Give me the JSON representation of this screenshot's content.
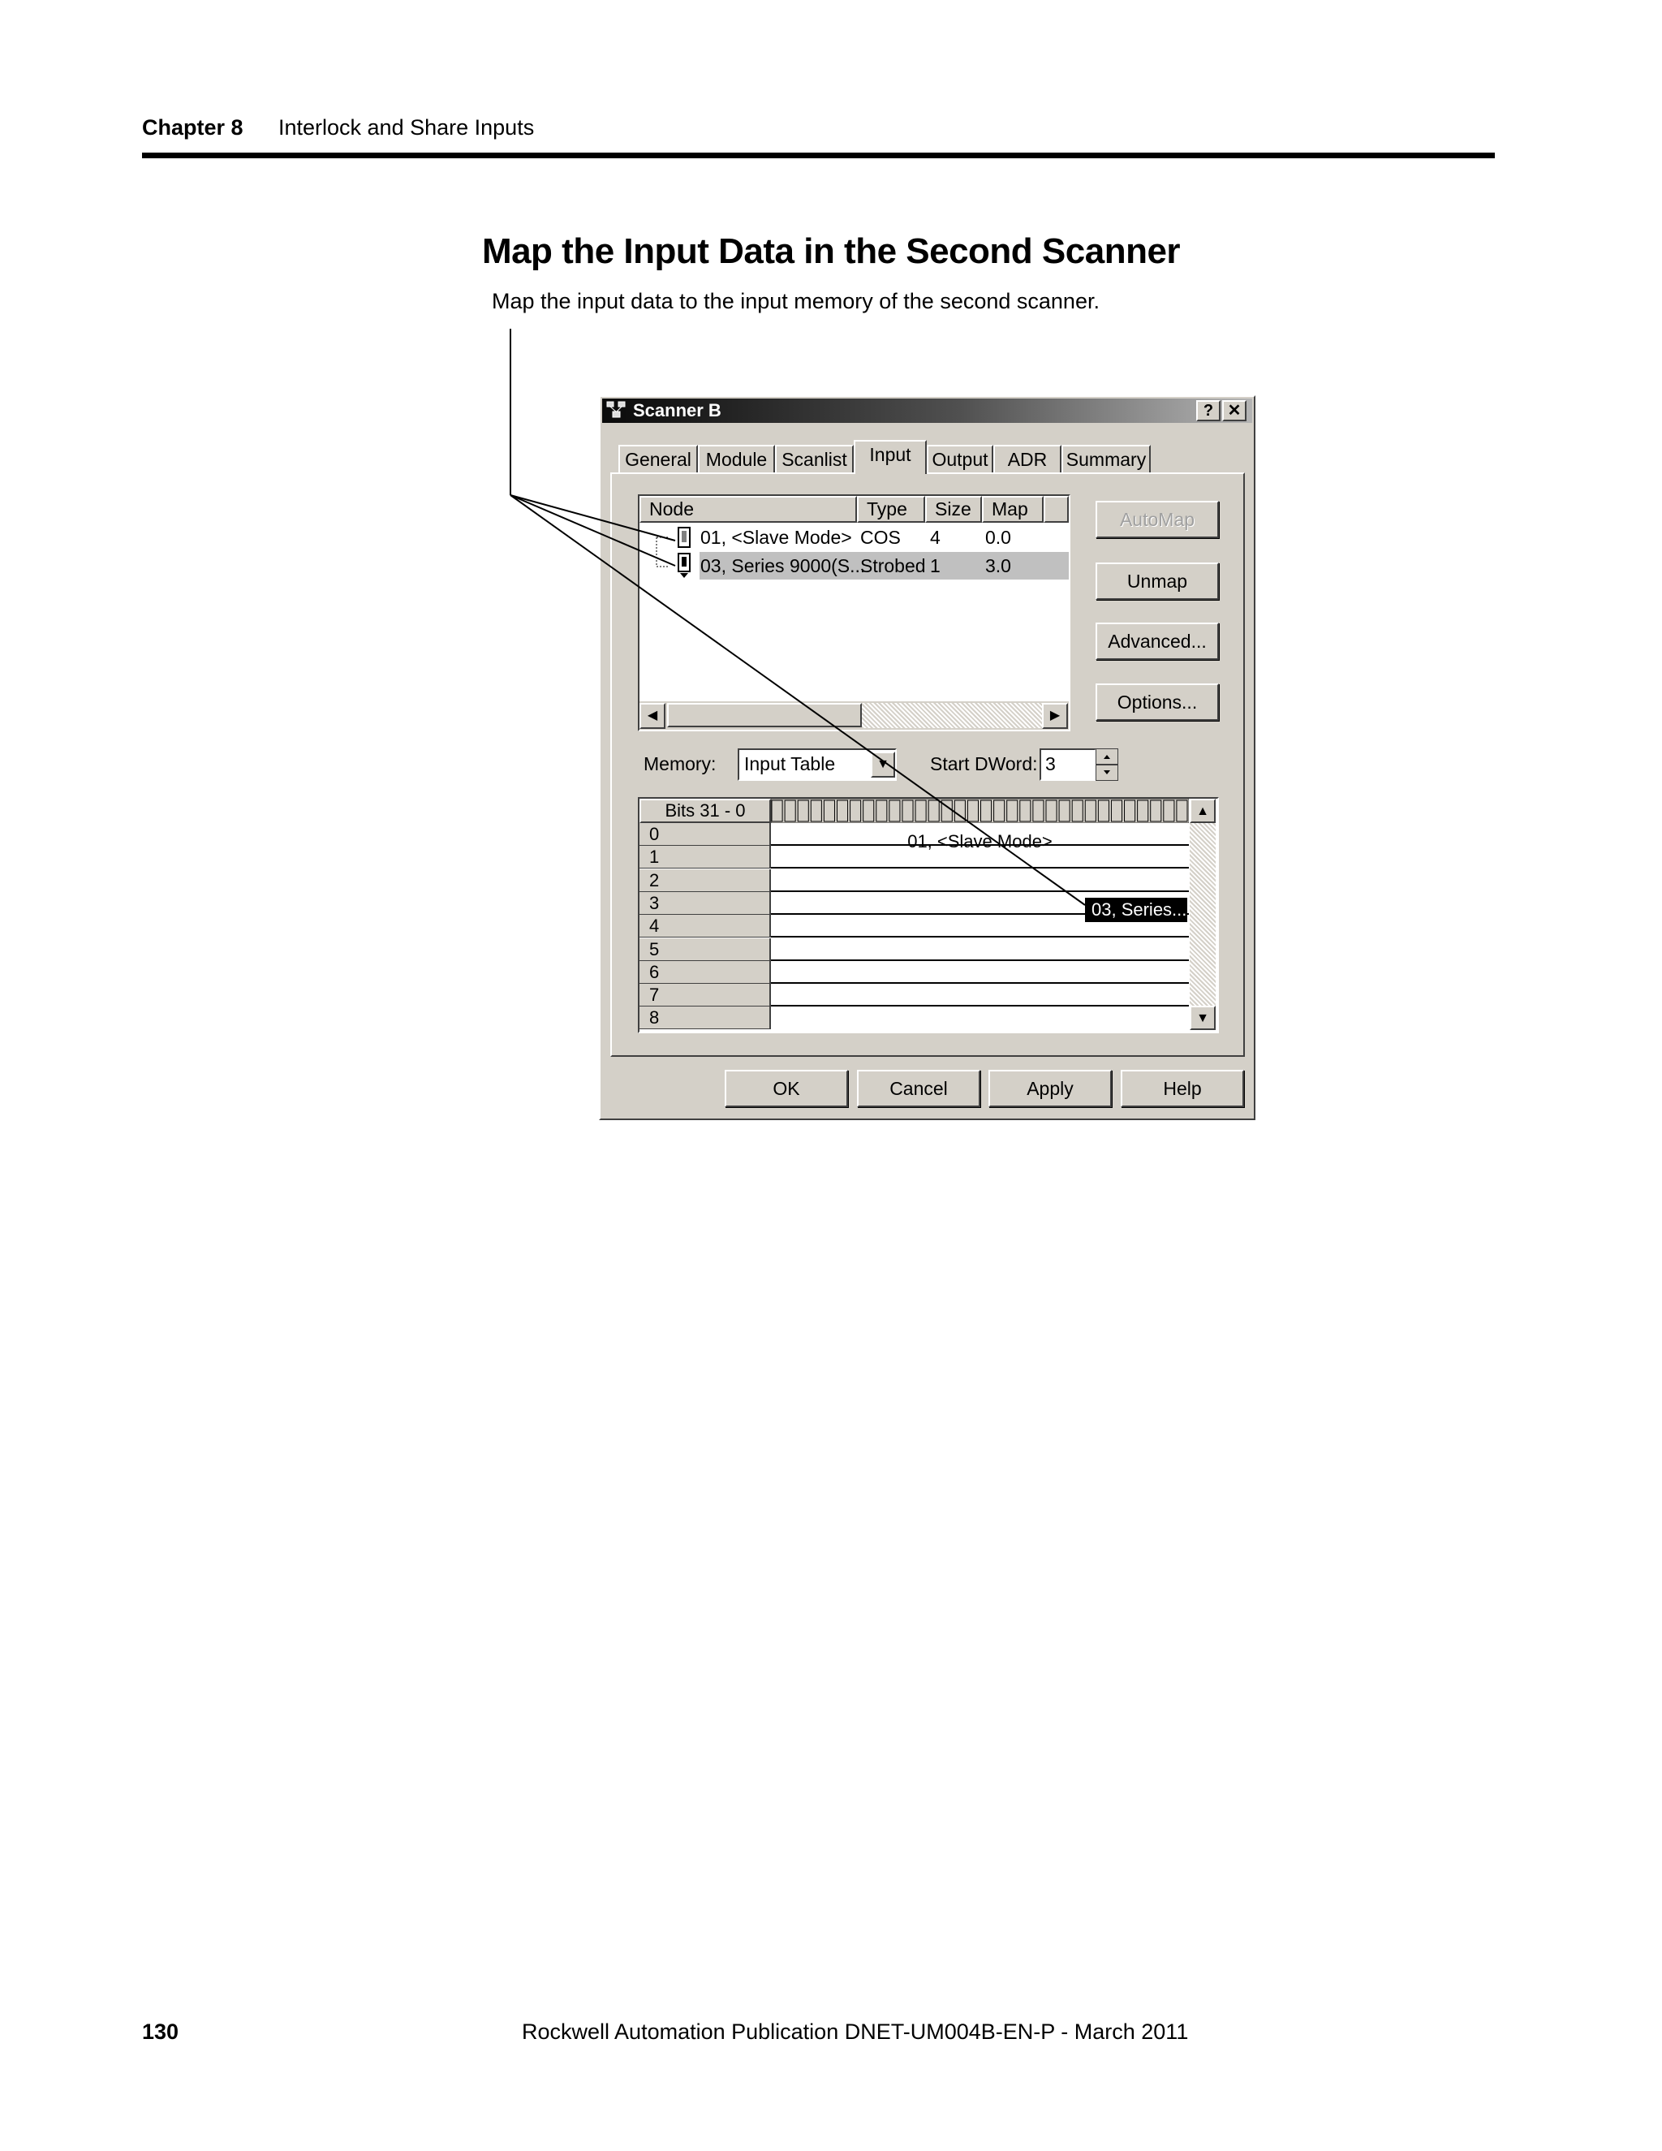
{
  "page": {
    "chapter_label": "Chapter 8",
    "chapter_title": "Interlock and Share Inputs",
    "section_title": "Map the Input Data in the Second Scanner",
    "intro_text": "Map the input data to the input memory of the second scanner.",
    "page_number": "130",
    "publication": "Rockwell Automation Publication DNET-UM004B-EN-P - March 2011"
  },
  "dialog": {
    "title": "Scanner B",
    "help_glyph": "?",
    "close_glyph": "✕",
    "tabs": [
      "General",
      "Module",
      "Scanlist",
      "Input",
      "Output",
      "ADR",
      "Summary"
    ],
    "active_tab": "Input",
    "node_columns": [
      "Node",
      "Type",
      "Size",
      "Map"
    ],
    "nodes": [
      {
        "node": "01, <Slave Mode>",
        "type": "COS",
        "size": "4",
        "map": "0.0"
      },
      {
        "node": "03, Series 9000(S...",
        "type": "Strobed",
        "size": "1",
        "map": "3.0"
      }
    ],
    "buttons": {
      "automap": "AutoMap",
      "unmap": "Unmap",
      "advanced": "Advanced...",
      "options": "Options..."
    },
    "memory_label": "Memory:",
    "memory_value": "Input Table",
    "start_dword_label": "Start DWord:",
    "start_dword_value": "3",
    "grid": {
      "header": "Bits 31 - 0",
      "rows": [
        "0",
        "1",
        "2",
        "3",
        "4",
        "5",
        "6",
        "7",
        "8"
      ],
      "cell_slave": "01, <Slave Mode>",
      "cell_series": "03, Series..."
    },
    "footer_buttons": [
      "OK",
      "Cancel",
      "Apply",
      "Help"
    ]
  }
}
